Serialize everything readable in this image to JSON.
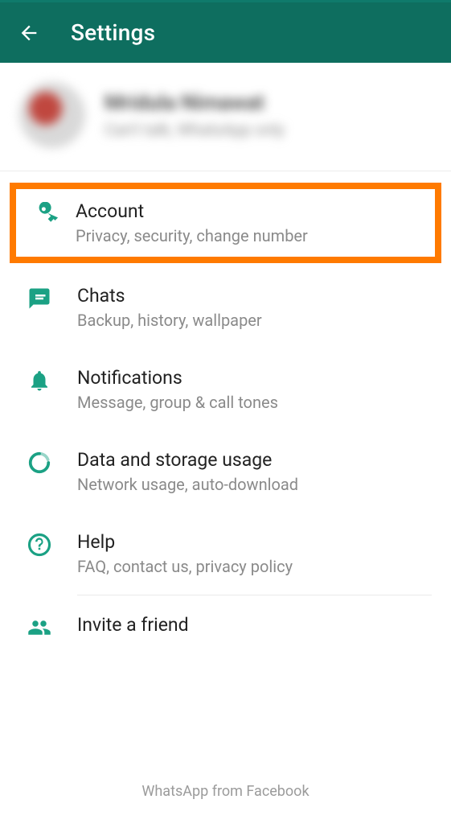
{
  "appbar": {
    "title": "Settings"
  },
  "profile": {
    "name": "Mridula Nimawat",
    "status": "Can't talk, WhatsApp only"
  },
  "items": [
    {
      "title": "Account",
      "sub": "Privacy, security, change number"
    },
    {
      "title": "Chats",
      "sub": "Backup, history, wallpaper"
    },
    {
      "title": "Notifications",
      "sub": "Message, group & call tones"
    },
    {
      "title": "Data and storage usage",
      "sub": "Network usage, auto-download"
    },
    {
      "title": "Help",
      "sub": "FAQ, contact us, privacy policy"
    },
    {
      "title": "Invite a friend",
      "sub": ""
    }
  ],
  "footer": "WhatsApp from Facebook"
}
